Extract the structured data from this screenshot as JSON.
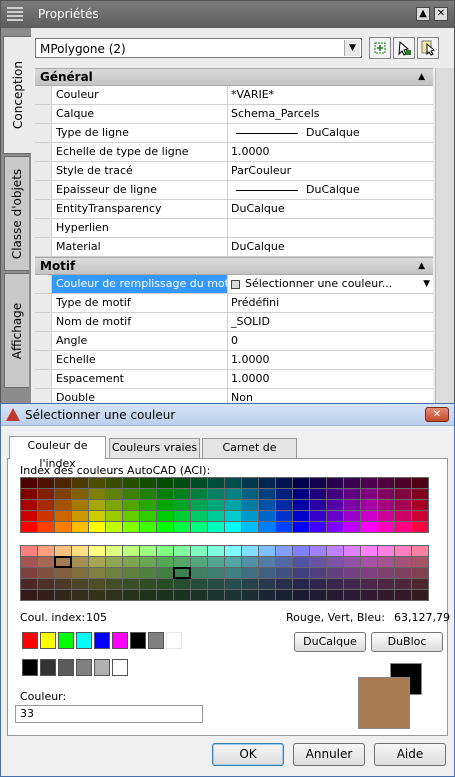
{
  "palette": {
    "title": "Propriétés",
    "pin_label": "▲",
    "close_label": "✕",
    "side_tabs": [
      "Conception",
      "Classe d'objets",
      "Affichage"
    ],
    "object_selector": {
      "value": "MPolygone (2)"
    },
    "tool_icons": [
      "quick-select-icon",
      "select-objects-icon",
      "toggle-pickadd-icon"
    ],
    "categories": [
      {
        "title": "Général",
        "rows": [
          {
            "name": "Couleur",
            "value": "*VARIE*",
            "line": false
          },
          {
            "name": "Calque",
            "value": "Schema_Parcels",
            "line": false
          },
          {
            "name": "Type de ligne",
            "value": "DuCalque",
            "line": true
          },
          {
            "name": "Echelle de type de ligne",
            "value": "1.0000",
            "line": false
          },
          {
            "name": "Style de tracé",
            "value": "ParCouleur",
            "line": false
          },
          {
            "name": "Epaisseur de ligne",
            "value": "DuCalque",
            "line": true
          },
          {
            "name": "EntityTransparency",
            "value": "DuCalque",
            "line": false
          },
          {
            "name": "Hyperlien",
            "value": "",
            "line": false
          },
          {
            "name": "Material",
            "value": "DuCalque",
            "line": false
          }
        ]
      },
      {
        "title": "Motif",
        "rows": [
          {
            "name": "Couleur de remplissage du motif",
            "value": "Sélectionner une couleur...",
            "selected": true
          },
          {
            "name": "Type de motif",
            "value": "Prédéfini"
          },
          {
            "name": "Nom de motif",
            "value": "_SOLID"
          },
          {
            "name": "Angle",
            "value": "0"
          },
          {
            "name": "Echelle",
            "value": "1.0000"
          },
          {
            "name": "Espacement",
            "value": "1.0000"
          },
          {
            "name": "Double",
            "value": "Non"
          }
        ]
      }
    ]
  },
  "dialog": {
    "title": "Sélectionner une couleur",
    "tabs": [
      "Couleur de l'index",
      "Couleurs vraies",
      "Carnet de couleurs"
    ],
    "aci_label": "Index des couleurs AutoCAD (ACI):",
    "coul_index_label": "Coul. index:",
    "coul_index_value": "105",
    "rgb_label": "Rouge, Vert, Bleu:",
    "rgb_value": "63,127,79",
    "bylayer_label": "DuCalque",
    "byblock_label": "DuBloc",
    "color_label": "Couleur:",
    "color_value": "33",
    "ok_label": "OK",
    "cancel_label": "Annuler",
    "help_label": "Aide",
    "colors": {
      "new_color": "#a87b53",
      "old_color": "#000000",
      "std_row1": [
        "#ff0000",
        "#ffff00",
        "#00ff00",
        "#00ffff",
        "#0000ff",
        "#ff00ff",
        "#000000",
        "#808080",
        ""
      ],
      "std_row2": [
        "#000000",
        "#333333",
        "#5b5b5b",
        "#808080",
        "#b0b0b0",
        "#ffffff"
      ]
    }
  }
}
